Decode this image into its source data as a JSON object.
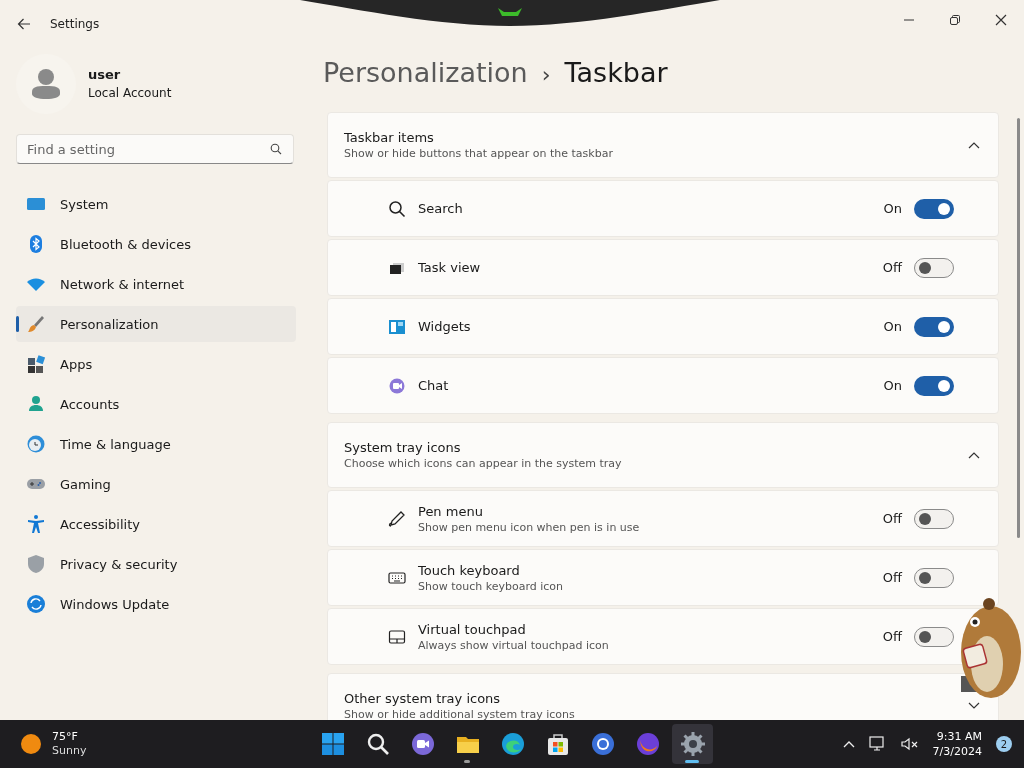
{
  "window": {
    "title": "Settings"
  },
  "profile": {
    "name": "user",
    "account": "Local Account"
  },
  "search": {
    "placeholder": "Find a setting"
  },
  "sidebar": {
    "items": [
      {
        "label": "System",
        "selected": false
      },
      {
        "label": "Bluetooth & devices",
        "selected": false
      },
      {
        "label": "Network & internet",
        "selected": false
      },
      {
        "label": "Personalization",
        "selected": true
      },
      {
        "label": "Apps",
        "selected": false
      },
      {
        "label": "Accounts",
        "selected": false
      },
      {
        "label": "Time & language",
        "selected": false
      },
      {
        "label": "Gaming",
        "selected": false
      },
      {
        "label": "Accessibility",
        "selected": false
      },
      {
        "label": "Privacy & security",
        "selected": false
      },
      {
        "label": "Windows Update",
        "selected": false
      }
    ]
  },
  "breadcrumb": {
    "parent": "Personalization",
    "separator": "›",
    "current": "Taskbar"
  },
  "sections": [
    {
      "title": "Taskbar items",
      "subtitle": "Show or hide buttons that appear on the taskbar",
      "expanded": true,
      "items": [
        {
          "label": "Search",
          "on": true,
          "state_text": "On"
        },
        {
          "label": "Task view",
          "on": false,
          "state_text": "Off"
        },
        {
          "label": "Widgets",
          "on": true,
          "state_text": "On"
        },
        {
          "label": "Chat",
          "on": true,
          "state_text": "On"
        }
      ]
    },
    {
      "title": "System tray icons",
      "subtitle": "Choose which icons can appear in the system tray",
      "expanded": true,
      "items": [
        {
          "label": "Pen menu",
          "description": "Show pen menu icon when pen is in use",
          "on": false,
          "state_text": "Off"
        },
        {
          "label": "Touch keyboard",
          "description": "Show touch keyboard icon",
          "on": false,
          "state_text": "Off"
        },
        {
          "label": "Virtual touchpad",
          "description": "Always show virtual touchpad icon",
          "on": false,
          "state_text": "Off"
        }
      ]
    },
    {
      "title": "Other system tray icons",
      "subtitle": "Show or hide additional system tray icons",
      "expanded": false
    }
  ],
  "taskbar": {
    "weather": {
      "temperature": "75°F",
      "condition": "Sunny"
    },
    "apps": [
      {
        "running": false,
        "active": false
      },
      {
        "running": false,
        "active": false
      },
      {
        "running": false,
        "active": false
      },
      {
        "running": true,
        "active": false
      },
      {
        "running": false,
        "active": false
      },
      {
        "running": false,
        "active": false
      },
      {
        "running": false,
        "active": false
      },
      {
        "running": false,
        "active": false
      },
      {
        "running": true,
        "active": true
      }
    ],
    "time": "9:31 AM",
    "date": "7/3/2024",
    "notification_count": "2"
  }
}
